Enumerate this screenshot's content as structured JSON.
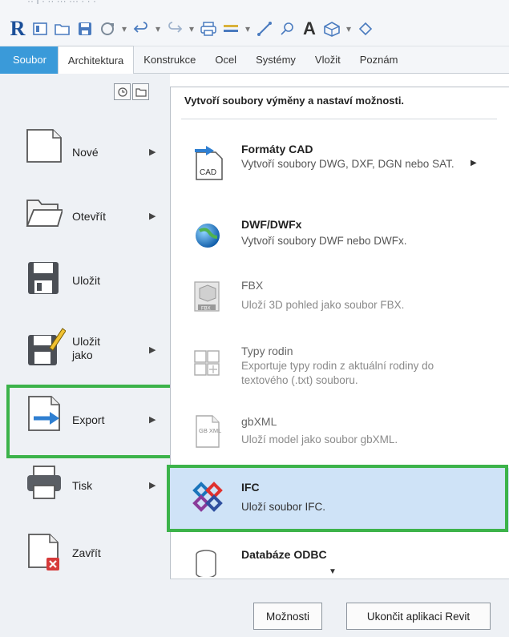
{
  "title_fragment": "·· I · ·· ··· ··· · · ·",
  "qat": {
    "logo": "R",
    "a_label": "A"
  },
  "tabs": [
    "Soubor",
    "Architektura",
    "Konstrukce",
    "Ocel",
    "Systémy",
    "Vložit",
    "Poznám"
  ],
  "left_menu": [
    {
      "label": "Nové",
      "has_arrow": true
    },
    {
      "label": "Otevřít",
      "has_arrow": true
    },
    {
      "label": "Uložit",
      "has_arrow": false
    },
    {
      "label": "Uložit\njako",
      "has_arrow": true
    },
    {
      "label": "Export",
      "has_arrow": true,
      "highlighted": true
    },
    {
      "label": "Tisk",
      "has_arrow": true
    },
    {
      "label": "Zavřít",
      "has_arrow": false
    }
  ],
  "submenu": {
    "header": "Vytvoří soubory výměny a nastaví možnosti.",
    "items": [
      {
        "title": "Formáty CAD",
        "desc": "Vytvoří soubory DWG, DXF, DGN nebo SAT.",
        "has_arrow": true,
        "enabled": true
      },
      {
        "title": "DWF/DWFx",
        "desc": "Vytvoří soubory DWF nebo DWFx.",
        "enabled": true
      },
      {
        "title": "FBX",
        "desc": "Uloží 3D pohled jako soubor FBX.",
        "enabled": false
      },
      {
        "title": "Typy rodin",
        "desc": "Exportuje typy rodin z aktuální rodiny do textového (.txt) souboru.",
        "enabled": false
      },
      {
        "title": "gbXML",
        "desc": "Uloží model jako soubor gbXML.",
        "enabled": false
      },
      {
        "title": "IFC",
        "desc": "Uloží soubor IFC.",
        "enabled": true,
        "selected": true
      },
      {
        "title": "Databáze ODBC",
        "desc": "",
        "enabled": true
      }
    ]
  },
  "icons": {
    "cad": "CAD",
    "gbxml": "GB XML",
    "fbx": "FBX"
  },
  "buttons": {
    "options": "Možnosti",
    "exit": "Ukončit aplikaci Revit"
  },
  "colors": {
    "file_tab": "#3a9ad9",
    "highlight": "#3cb34a",
    "selected_bg": "#cfe3f7"
  }
}
